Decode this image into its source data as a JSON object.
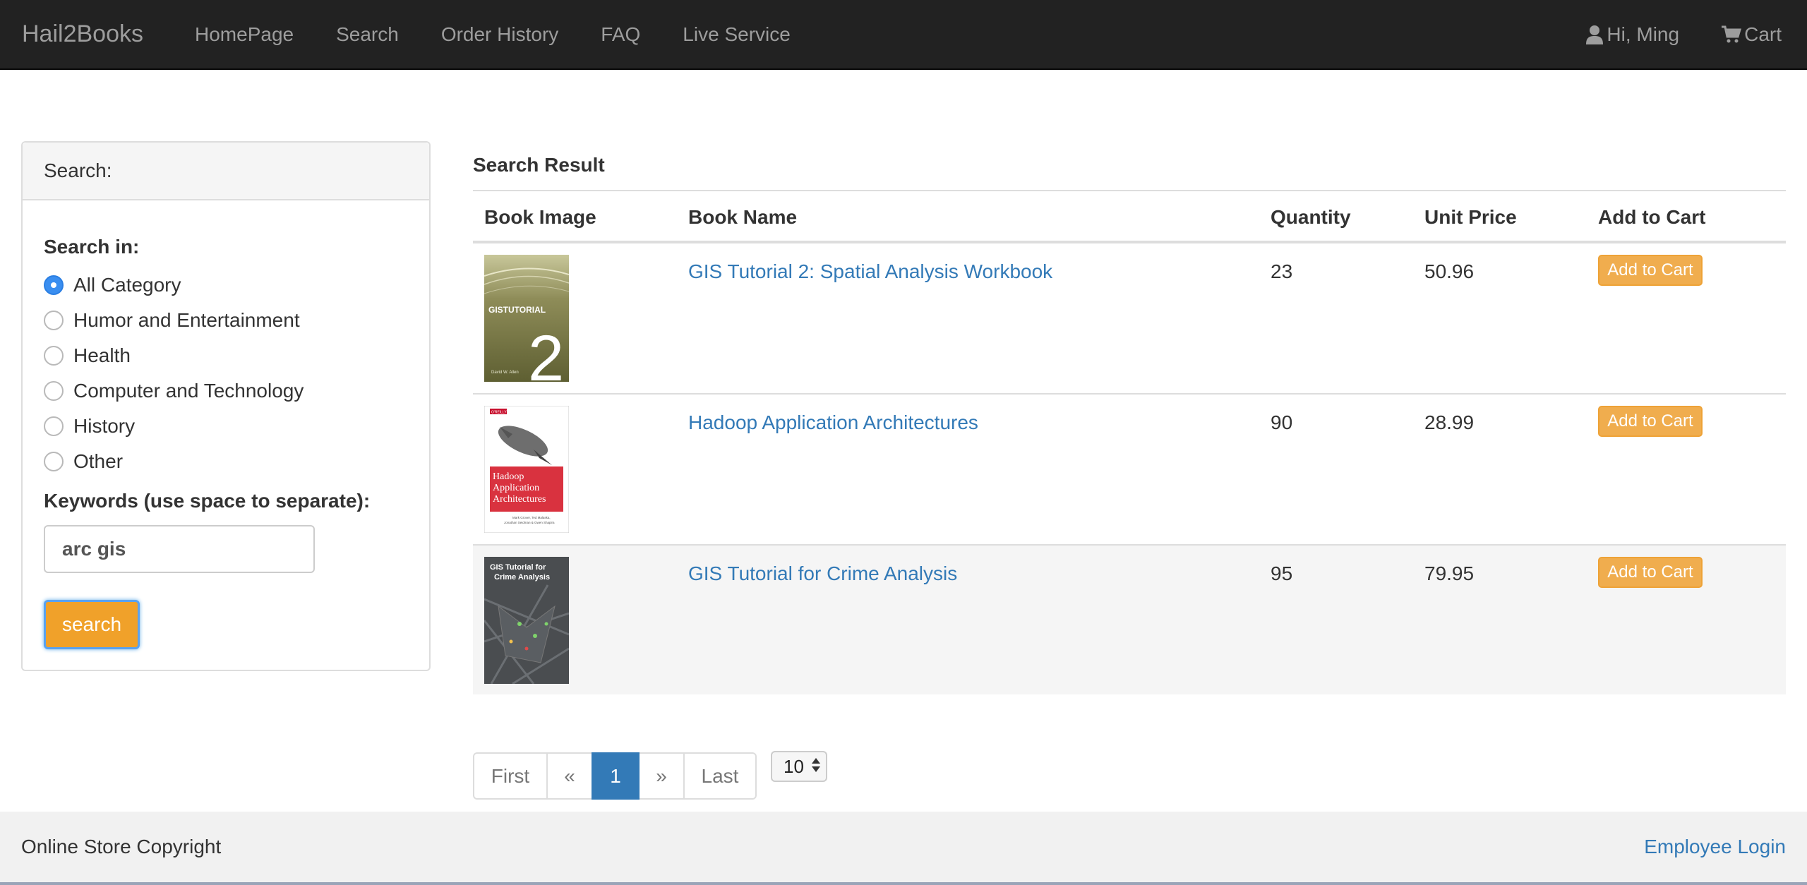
{
  "nav": {
    "brand": "Hail2Books",
    "links": [
      "HomePage",
      "Search",
      "Order History",
      "FAQ",
      "Live Service"
    ],
    "user_label": "Hi, Ming",
    "cart_label": "Cart"
  },
  "search_panel": {
    "heading": "Search:",
    "search_in_label": "Search in:",
    "categories": [
      "All Category",
      "Humor and Entertainment",
      "Health",
      "Computer and Technology",
      "History",
      "Other"
    ],
    "selected_category": "All Category",
    "keywords_label": "Keywords (use space to separate):",
    "keywords_value": "arc gis",
    "search_button": "search"
  },
  "results": {
    "title": "Search Result",
    "columns": [
      "Book Image",
      "Book Name",
      "Quantity",
      "Unit Price",
      "Add to Cart"
    ],
    "rows": [
      {
        "name": "GIS Tutorial 2: Spatial Analysis Workbook",
        "quantity": "23",
        "price": "50.96",
        "action": "Add to Cart"
      },
      {
        "name": "Hadoop Application Architectures",
        "quantity": "90",
        "price": "28.99",
        "action": "Add to Cart"
      },
      {
        "name": "GIS Tutorial for Crime Analysis",
        "quantity": "95",
        "price": "79.95",
        "action": "Add to Cart"
      }
    ],
    "covers": [
      {
        "top": "GISTUTORIAL",
        "big": "2",
        "author": "David W. Allen"
      },
      {
        "publisher": "O'REILLY",
        "title_lines": [
          "Hadoop",
          "Application",
          "Architectures"
        ],
        "authors": [
          "Mark Grover, Ted Malaska,",
          "Jonathan Seidman & Gwen Shapira"
        ]
      },
      {
        "title_lines": [
          "GIS Tutorial for",
          "Crime Analysis"
        ]
      }
    ]
  },
  "pagination": {
    "first": "First",
    "prev": "«",
    "current": "1",
    "next": "»",
    "last": "Last",
    "page_size": "10"
  },
  "footer": {
    "copyright": "Online Store Copyright",
    "employee_login": "Employee Login"
  },
  "colors": {
    "navbar": "#222222",
    "link": "#337ab7",
    "add_button": "#f0ad4e",
    "search_button": "#f0a12a",
    "active_page": "#337ab7"
  }
}
